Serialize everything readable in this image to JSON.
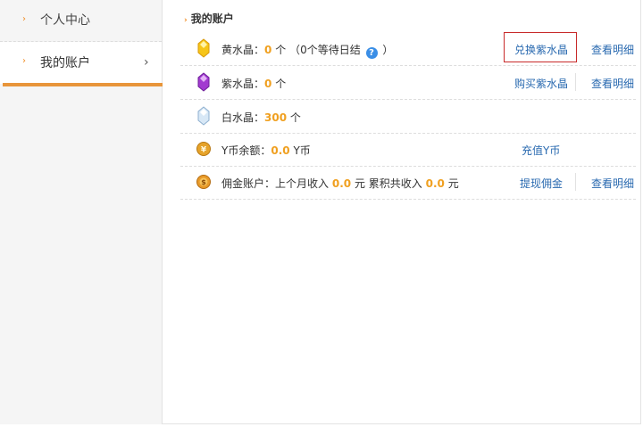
{
  "sidebar": {
    "items": [
      {
        "label": "个人中心"
      },
      {
        "label": "我的账户"
      }
    ],
    "active_chevron": "›"
  },
  "main": {
    "title": "我的账户",
    "rows": [
      {
        "icon": "yellow-crystal-icon",
        "label": "黄水晶：",
        "value": "0",
        "unit": "个",
        "note_open": "（",
        "note_value": "0个等待日结",
        "note_close": "）",
        "action1": "兑换紫水晶",
        "action2": "查看明细"
      },
      {
        "icon": "purple-crystal-icon",
        "label": "紫水晶：",
        "value": "0",
        "unit": "个",
        "action1": "购买紫水晶",
        "action2": "查看明细"
      },
      {
        "icon": "white-crystal-icon",
        "label": "白水晶：",
        "value": "300",
        "unit": "个"
      },
      {
        "icon": "y-coin-icon",
        "label": "Y币余额：",
        "value": "0.0",
        "unit": "Y币",
        "action1": "充值Y币"
      },
      {
        "icon": "commission-coin-icon",
        "label": "佣金账户：上个月收入",
        "value": "0.0",
        "mid": "元 累积共收入",
        "value2": "0.0",
        "unit": "元",
        "action1": "提现佣金",
        "action2": "查看明细"
      }
    ]
  },
  "colors": {
    "accent_orange": "#e8953a",
    "link_blue": "#2a6ab0",
    "value_orange": "#f0a020",
    "highlight_red": "#c82a2a"
  }
}
